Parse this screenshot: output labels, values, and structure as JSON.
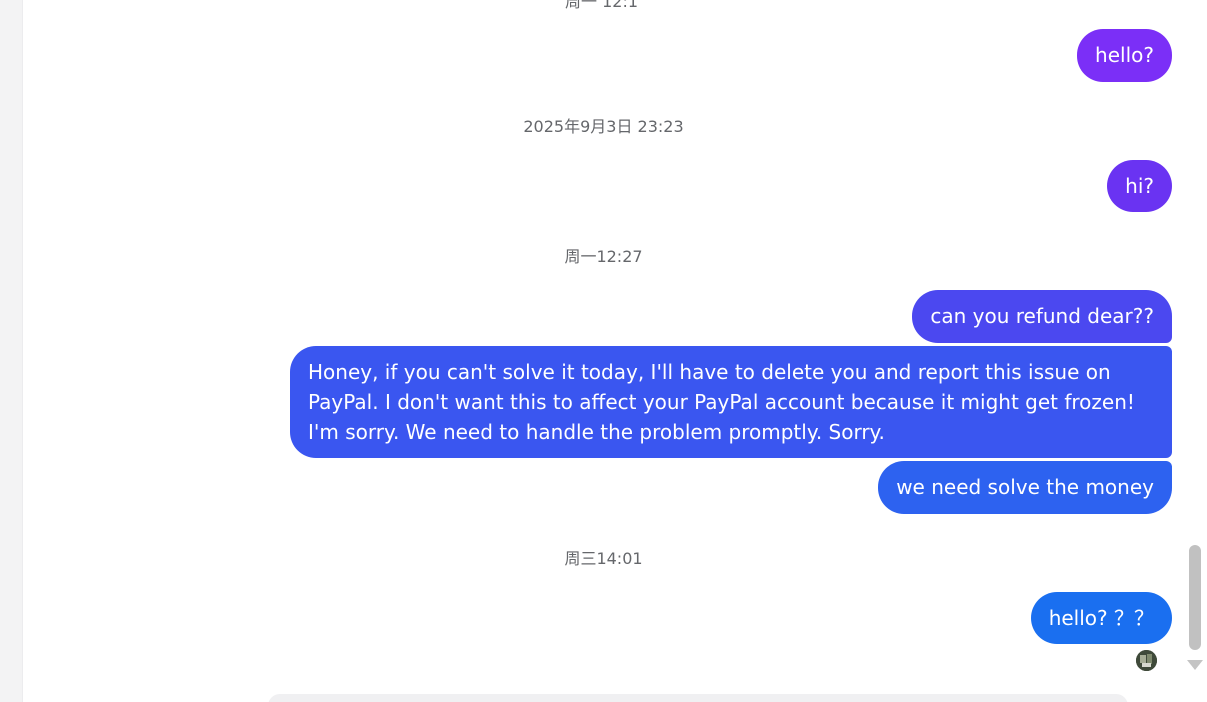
{
  "top_partial_timestamp": "周一 12:1",
  "messages": [
    {
      "text": "hello?",
      "color": "#7b2ff7"
    },
    {
      "text": "hi?",
      "color": "#6a33f2"
    },
    {
      "text": "can you refund dear??",
      "color": "#4b48f0"
    },
    {
      "text_lines": [
        "Honey, if you can't solve it today, I'll have to delete you and report this issue on",
        "PayPal. I don't want this to affect your PayPal account because it might get frozen!",
        "I'm sorry. We need to handle the problem promptly. Sorry."
      ],
      "color": "#3a56f0"
    },
    {
      "text": "we need solve the money",
      "color": "#2d62f0"
    },
    {
      "text": "hello? ？？",
      "color": "#1a6ff0"
    }
  ],
  "timestamps": [
    "2025年9月3日 23:23",
    "周一12:27",
    "周三14:01"
  ],
  "colors": {
    "timestamp": "#65676b",
    "scroll_thumb": "#c1c1c1"
  }
}
